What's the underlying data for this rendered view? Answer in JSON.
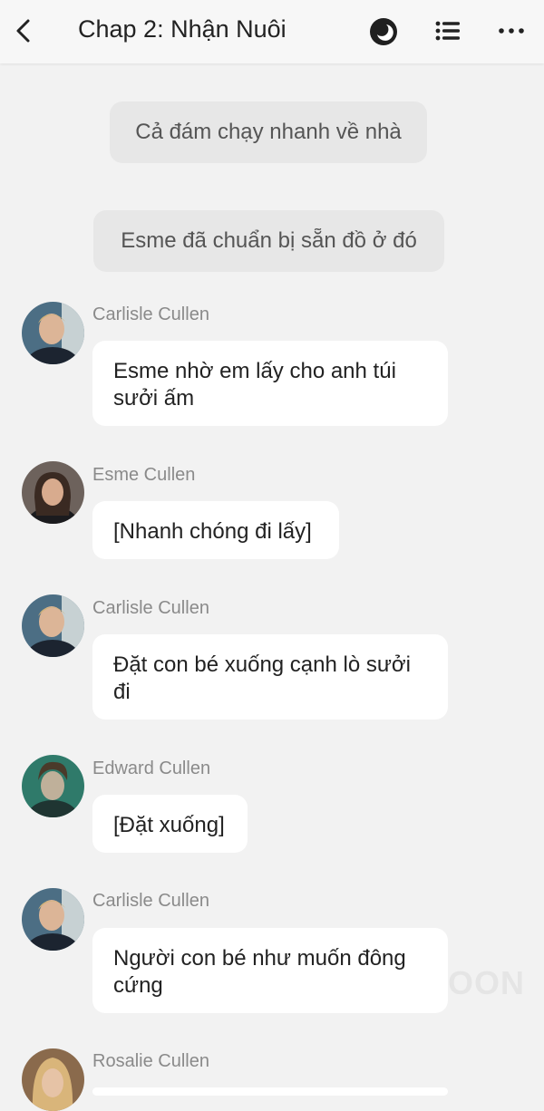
{
  "header": {
    "title": "Chap 2: Nhận Nuôi",
    "back_icon": "chevron-left-icon",
    "night_mode_icon": "moon-icon",
    "toc_icon": "list-icon",
    "more_icon": "more-horizontal-icon"
  },
  "messages": [
    {
      "type": "narration",
      "text": "Cả đám chạy nhanh về nhà"
    },
    {
      "type": "narration",
      "text": "Esme đã chuẩn bị sẵn đồ ở đó"
    },
    {
      "type": "dialogue",
      "speaker": "Carlisle Cullen",
      "text": "Esme nhờ em lấy cho anh túi sưởi ấm"
    },
    {
      "type": "dialogue",
      "speaker": "Esme Cullen",
      "text": "[Nhanh chóng đi lấy]"
    },
    {
      "type": "dialogue",
      "speaker": "Carlisle Cullen",
      "text": "Đặt con bé xuống cạnh lò sưởi đi"
    },
    {
      "type": "dialogue",
      "speaker": "Edward Cullen",
      "text": "[Đặt xuống]"
    },
    {
      "type": "dialogue",
      "speaker": "Carlisle Cullen",
      "text": "Người con bé như muốn đông cứng"
    },
    {
      "type": "dialogue",
      "speaker": "Rosalie Cullen",
      "text": ""
    }
  ],
  "watermark": "OON",
  "colors": {
    "page_background": "#f2f2f2",
    "narration_background": "#e7e7e7",
    "bubble_background": "#ffffff",
    "speaker_name": "#8a8a8a"
  }
}
